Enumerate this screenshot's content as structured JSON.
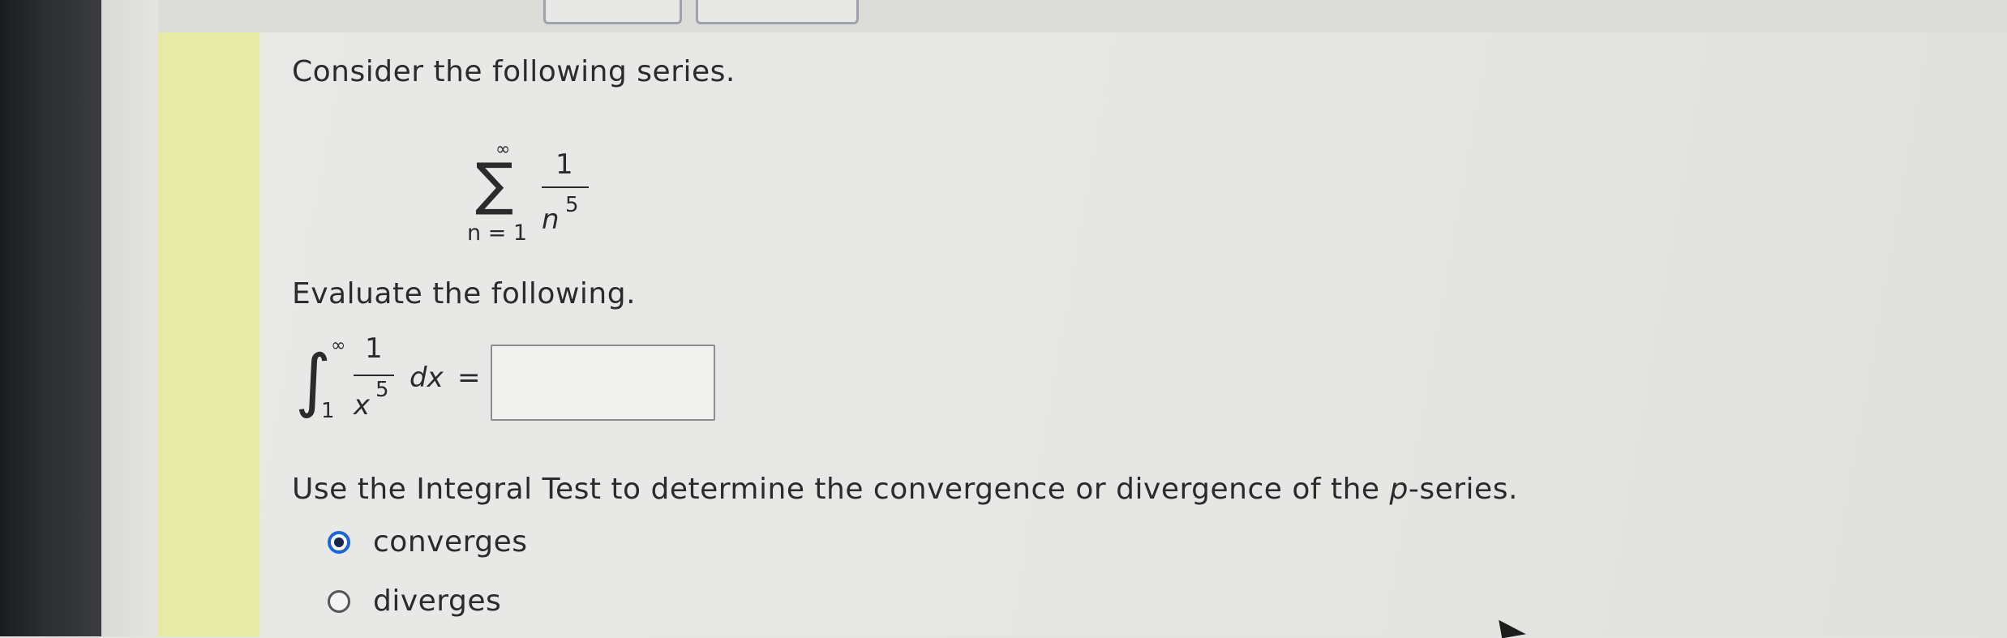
{
  "question": {
    "intro": "Consider the following series.",
    "series": {
      "sum_symbol": "∑",
      "upper_limit": "∞",
      "lower_limit": "n = 1",
      "numerator": "1",
      "denominator_base": "n",
      "denominator_exponent": "5"
    },
    "evaluate_text": "Evaluate the following.",
    "integral": {
      "integral_symbol": "∫",
      "upper_limit": "∞",
      "lower_limit": "1",
      "numerator": "1",
      "denominator_base": "x",
      "denominator_exponent": "5",
      "differential": "dx",
      "equals": "=",
      "answer_value": ""
    },
    "test_prompt_before": "Use the Integral Test to determine the convergence or divergence of the ",
    "test_prompt_var": "p",
    "test_prompt_after": "-series.",
    "options": [
      {
        "label": "converges",
        "selected": true
      },
      {
        "label": "diverges",
        "selected": false
      }
    ]
  },
  "colors": {
    "accent_radio": "#1a66d4",
    "yellow_bar": "#e7e9a6",
    "panel_bg": "#e6e6e4"
  }
}
